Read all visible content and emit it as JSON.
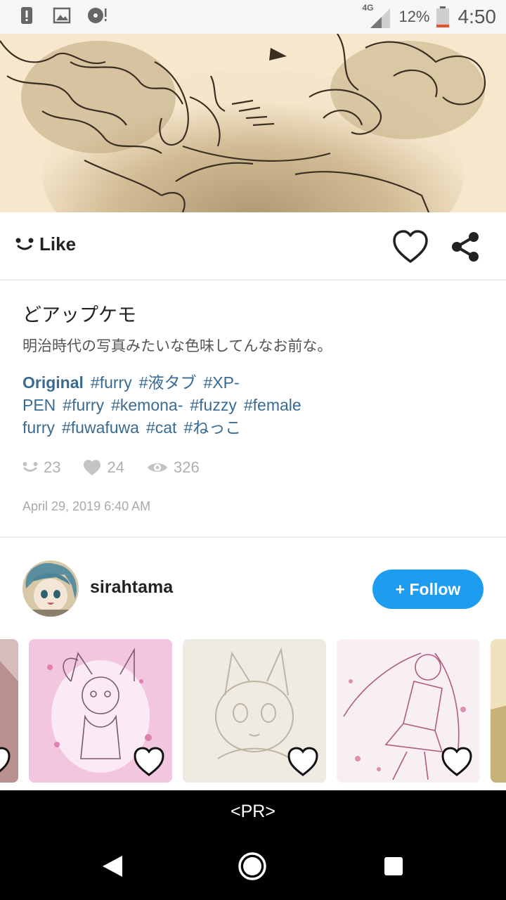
{
  "status_bar": {
    "network": "4G",
    "battery_percent": "12%",
    "time": "4:50",
    "battery_level": 0.12,
    "notification_icons": [
      "alert-icon",
      "image-icon",
      "disc-icon"
    ]
  },
  "actions": {
    "like_label": "Like"
  },
  "post": {
    "title": "どアップケモ",
    "description": "明治時代の写真みたいな色味してんなお前な。",
    "tags": [
      "Original",
      "#furry",
      "#液タブ",
      "#XP-PEN",
      "#furry",
      "#kemona-",
      "#fuzzy",
      "#female furry",
      "#fuwafuwa",
      "#cat",
      "#ねっこ"
    ],
    "stats": {
      "likes": "23",
      "favorites": "24",
      "views": "326"
    },
    "date": "April 29, 2019 6:40 AM"
  },
  "author": {
    "name": "sirahtama",
    "follow_label": "+ Follow"
  },
  "footer": {
    "pr_label": "<PR>"
  },
  "colors": {
    "accent": "#1e9cf0",
    "tag": "#3a6b93",
    "hero_bg": "#f6e7cd"
  }
}
